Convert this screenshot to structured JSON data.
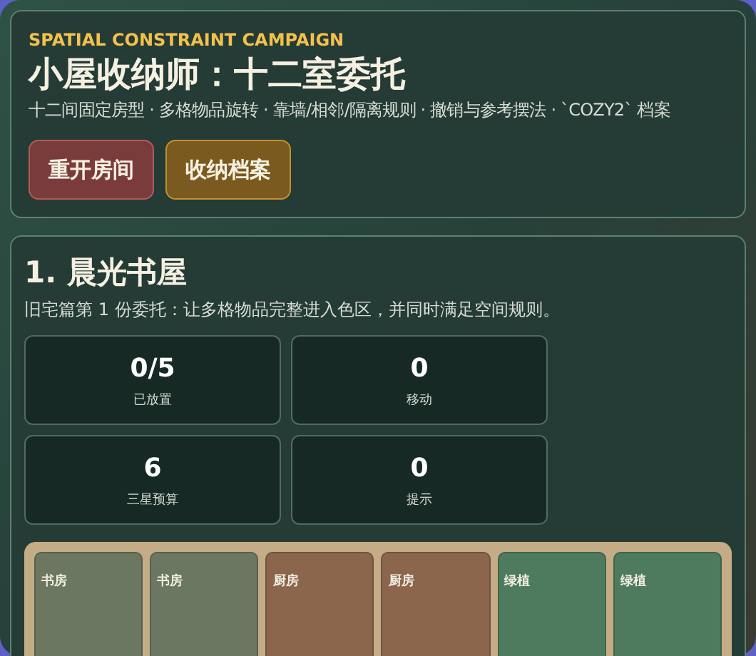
{
  "header": {
    "eyebrow": "SPATIAL CONSTRAINT CAMPAIGN",
    "title": "小屋收纳师：十二室委托",
    "subtitle": "十二间固定房型 · 多格物品旋转 · 靠墙/相邻/隔离规则 · 撤销与参考摆法 · `COZY2` 档案",
    "buttons": [
      {
        "label": "重开房间",
        "kind": "danger"
      },
      {
        "label": "收纳档案",
        "kind": "archive"
      }
    ]
  },
  "level": {
    "title": "1. 晨光书屋",
    "description": "旧宅篇第 1 份委托：让多格物品完整进入色区，并同时满足空间规则。",
    "stats": [
      {
        "value": "0/5",
        "label": "已放置"
      },
      {
        "value": "0",
        "label": "移动"
      },
      {
        "value": "6",
        "label": "三星预算"
      },
      {
        "value": "0",
        "label": "提示"
      }
    ],
    "board": [
      {
        "label": "书房",
        "color": "#6b7761"
      },
      {
        "label": "书房",
        "color": "#6b7761"
      },
      {
        "label": "厨房",
        "color": "#8b664d"
      },
      {
        "label": "厨房",
        "color": "#8b664d"
      },
      {
        "label": "绿植",
        "color": "#4e7a5e"
      },
      {
        "label": "绿植",
        "color": "#4e7a5e"
      }
    ]
  }
}
